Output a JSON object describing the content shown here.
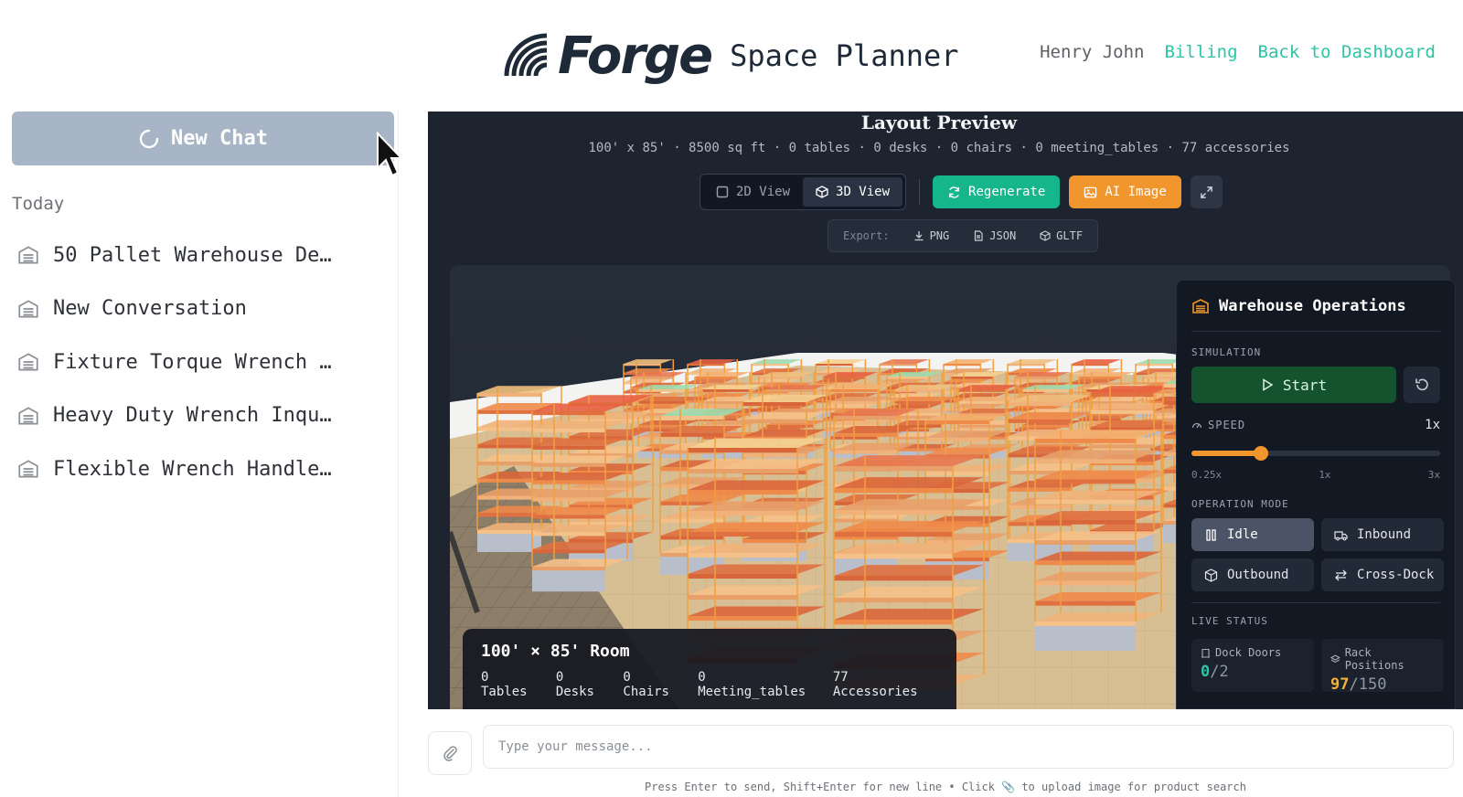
{
  "header": {
    "brand": "Forge",
    "product": "Space Planner",
    "user": "Henry John",
    "billing_link": "Billing",
    "dashboard_link": "Back to Dashboard"
  },
  "sidebar": {
    "new_chat_label": "New Chat",
    "section_today": "Today",
    "items": [
      {
        "label": "50 Pallet Warehouse De…"
      },
      {
        "label": "New Conversation"
      },
      {
        "label": "Fixture Torque Wrench …"
      },
      {
        "label": "Heavy Duty Wrench Inqu…"
      },
      {
        "label": "Flexible Wrench Handle…"
      }
    ]
  },
  "preview": {
    "title": "Layout Preview",
    "stats": "100' x 85' · 8500 sq ft · 0 tables · 0 desks · 0 chairs · 0 meeting_tables · 77 accessories",
    "view_2d": "2D View",
    "view_3d": "3D View",
    "regenerate": "Regenerate",
    "ai_image": "AI Image",
    "export_label": "Export:",
    "export_png": "PNG",
    "export_json": "JSON",
    "export_gltf": "GLTF"
  },
  "room_card": {
    "title": "100' × 85' Room",
    "tables": "0 Tables",
    "desks": "0 Desks",
    "chairs": "0 Chairs",
    "meeting_tables": "0 Meeting_tables",
    "accessories": "77 Accessories"
  },
  "operations": {
    "title": "Warehouse Operations",
    "simulation_label": "SIMULATION",
    "start_label": "Start",
    "speed_label": "SPEED",
    "speed_value": "1x",
    "speed_fraction": 0.28,
    "tick_min": "0.25x",
    "tick_mid": "1x",
    "tick_max": "3x",
    "mode_label": "OPERATION MODE",
    "modes": {
      "idle": "Idle",
      "inbound": "Inbound",
      "outbound": "Outbound",
      "crossdock": "Cross-Dock"
    },
    "live_status_label": "LIVE STATUS",
    "dock_doors_label": "Dock Doors",
    "dock_doors_current": "0",
    "dock_doors_total": "/2",
    "rack_positions_label": "Rack Positions",
    "rack_positions_current": "97",
    "rack_positions_total": "/150"
  },
  "composer": {
    "placeholder": "Type your message...",
    "hint": "Press Enter to send, Shift+Enter for new line • Click 📎 to upload image for product search"
  },
  "colors": {
    "accent_teal": "#16b68c",
    "accent_orange": "#f1962c",
    "link": "#2ec4a5",
    "panel_bg": "#1d2430"
  }
}
